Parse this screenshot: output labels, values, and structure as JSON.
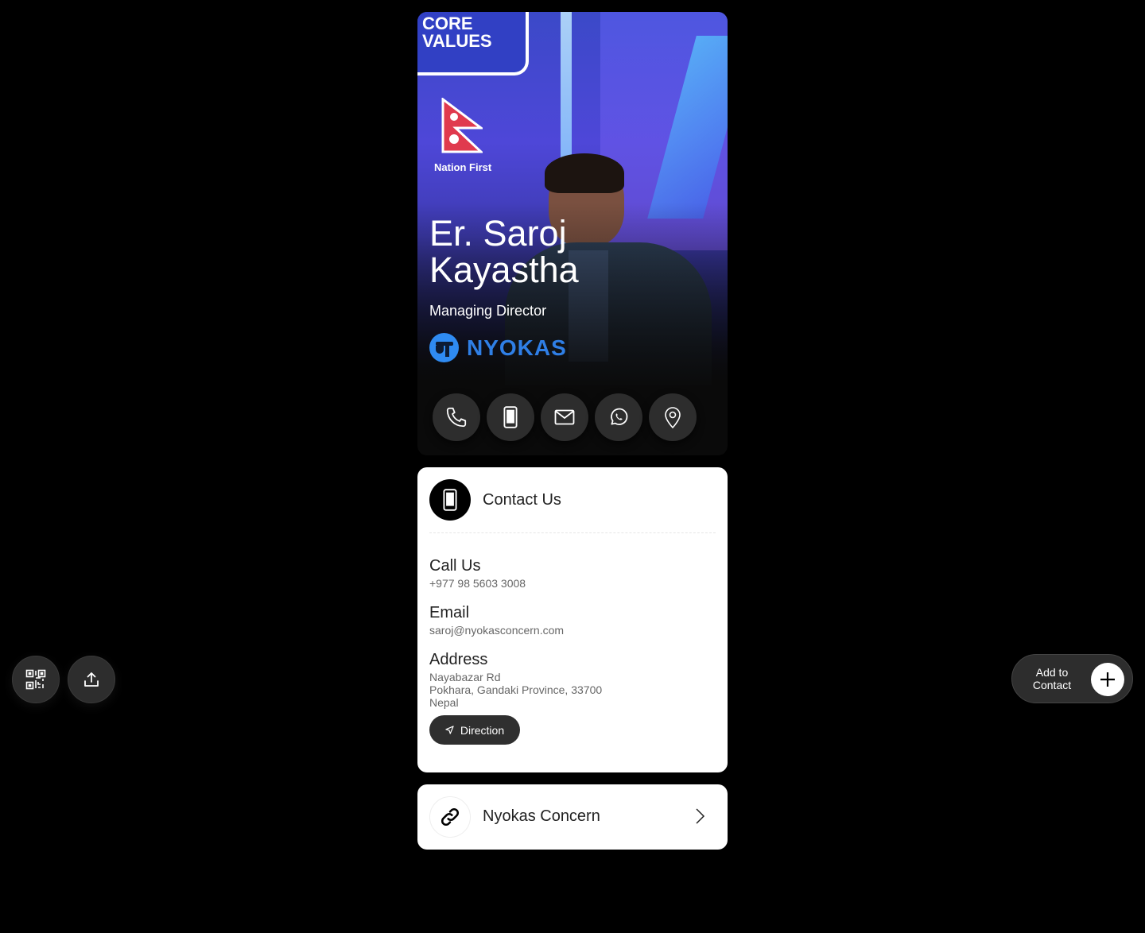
{
  "profile": {
    "name_line1": "Er. Saroj",
    "name_line2": "Kayastha",
    "role": "Managing Director",
    "company_logo_text": "NYOKAS",
    "photo_sign_text": "CORE VALUES",
    "photo_flag_text": "Nation First"
  },
  "actions": [
    {
      "icon": "phone-icon"
    },
    {
      "icon": "mobile-icon"
    },
    {
      "icon": "mail-icon"
    },
    {
      "icon": "whatsapp-icon"
    },
    {
      "icon": "location-pin-icon"
    }
  ],
  "contact": {
    "title": "Contact Us",
    "call_label": "Call Us",
    "call_value": "+977 98 5603 3008",
    "email_label": "Email",
    "email_value": "saroj@nyokasconcern.com",
    "address_label": "Address",
    "address_line1": "Nayabazar Rd",
    "address_line2": "Pokhara, Gandaki Province, 33700",
    "address_line3": "Nepal",
    "direction_label": "Direction"
  },
  "link": {
    "label": "Nyokas Concern"
  },
  "floating": {
    "add_contact_line1": "Add to",
    "add_contact_line2": "Contact"
  },
  "colors": {
    "background": "#000000",
    "card": "#ffffff",
    "button_dark": "#2d2d2d",
    "brand_blue": "#2f7fe6"
  }
}
